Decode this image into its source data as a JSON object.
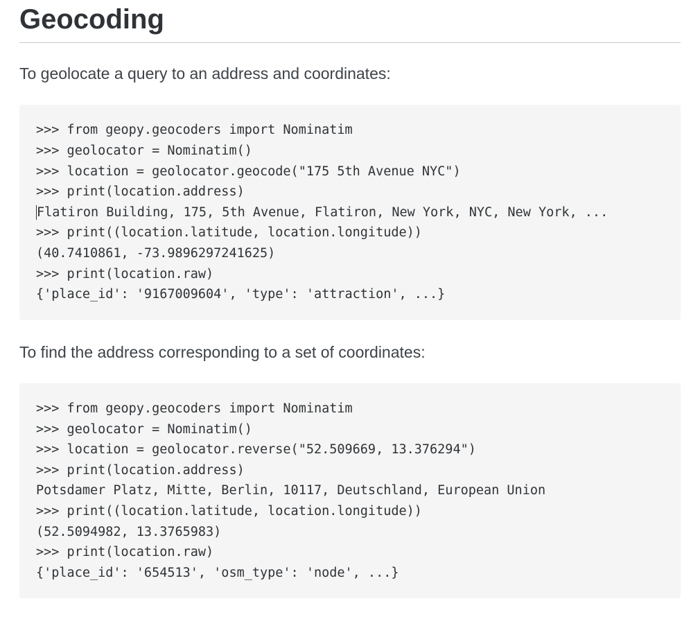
{
  "heading": "Geocoding",
  "intro1": "To geolocate a query to an address and coordinates:",
  "intro2": "To find the address corresponding to a set of coordinates:",
  "code1": {
    "l1": ">>> from geopy.geocoders import Nominatim",
    "l2": ">>> geolocator = Nominatim()",
    "l3": ">>> location = geolocator.geocode(\"175 5th Avenue NYC\")",
    "l4": ">>> print(location.address)",
    "l5": "Flatiron Building, 175, 5th Avenue, Flatiron, New York, NYC, New York, ...",
    "l6": ">>> print((location.latitude, location.longitude))",
    "l7": "(40.7410861, -73.9896297241625)",
    "l8": ">>> print(location.raw)",
    "l9": "{'place_id': '9167009604', 'type': 'attraction', ...}"
  },
  "code2": {
    "l1": ">>> from geopy.geocoders import Nominatim",
    "l2": ">>> geolocator = Nominatim()",
    "l3": ">>> location = geolocator.reverse(\"52.509669, 13.376294\")",
    "l4": ">>> print(location.address)",
    "l5": "Potsdamer Platz, Mitte, Berlin, 10117, Deutschland, European Union",
    "l6": ">>> print((location.latitude, location.longitude))",
    "l7": "(52.5094982, 13.3765983)",
    "l8": ">>> print(location.raw)",
    "l9": "{'place_id': '654513', 'osm_type': 'node', ...}"
  }
}
